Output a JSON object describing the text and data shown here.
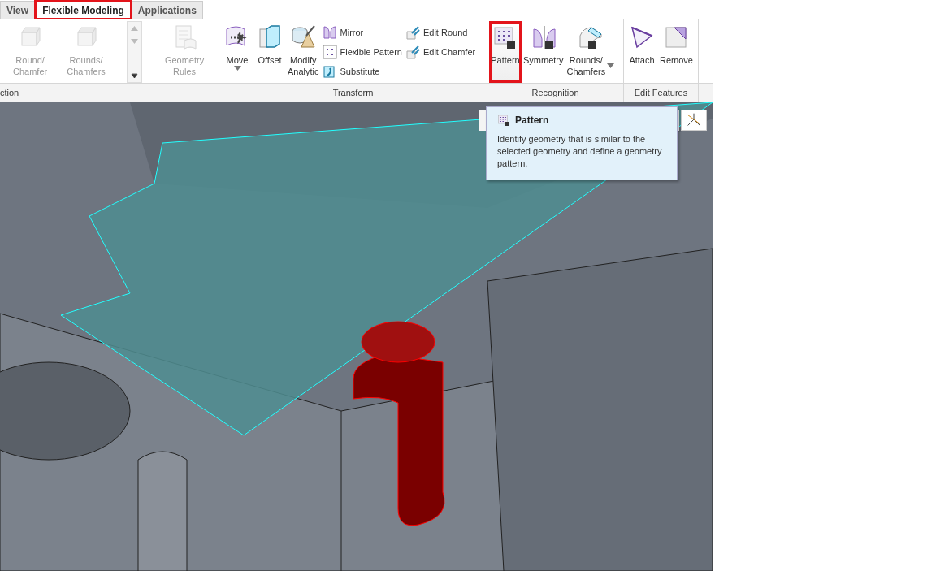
{
  "tabs": [
    {
      "label": "View",
      "selected": false,
      "highlighted": false
    },
    {
      "label": "Flexible Modeling",
      "selected": true,
      "highlighted": true
    },
    {
      "label": "Applications",
      "selected": false,
      "highlighted": false
    }
  ],
  "ribbon_groups": [
    {
      "label": "ction",
      "items": [
        {
          "kind": "large",
          "label": "Round/\nChamfer",
          "disabled": true,
          "highlighted": false
        },
        {
          "kind": "large",
          "label": "Rounds/\nChamfers",
          "disabled": true,
          "highlighted": false
        },
        {
          "kind": "gallery-scroll"
        },
        {
          "kind": "large",
          "label": "Geometry\nRules",
          "disabled": true,
          "highlighted": false
        }
      ]
    },
    {
      "label": "Transform",
      "items": [
        {
          "kind": "large",
          "label": "Move",
          "disabled": false,
          "highlighted": false,
          "dropdown": true
        },
        {
          "kind": "large",
          "label": "Offset",
          "disabled": false,
          "highlighted": false
        },
        {
          "kind": "large",
          "label": "Modify\nAnalytic",
          "disabled": false,
          "highlighted": false
        },
        {
          "kind": "stack",
          "entries": [
            "Mirror",
            "Flexible Pattern",
            "Substitute"
          ]
        },
        {
          "kind": "stack",
          "entries": [
            "Edit Round",
            "Edit Chamfer"
          ]
        }
      ]
    },
    {
      "label": "Recognition",
      "items": [
        {
          "kind": "large",
          "label": "Pattern",
          "disabled": false,
          "highlighted": true
        },
        {
          "kind": "large",
          "label": "Symmetry",
          "disabled": false,
          "highlighted": false
        },
        {
          "kind": "large",
          "label": "Rounds/\nChamfers",
          "disabled": false,
          "highlighted": false,
          "dropdown": true
        }
      ]
    },
    {
      "label": "Edit Features",
      "items": [
        {
          "kind": "large",
          "label": "Attach",
          "disabled": false,
          "highlighted": false
        },
        {
          "kind": "large",
          "label": "Remove",
          "disabled": false,
          "highlighted": false
        }
      ]
    }
  ],
  "tooltip": {
    "title": "Pattern",
    "text": "Identify geometry that is similar to the selected geometry and define a geometry pattern."
  }
}
